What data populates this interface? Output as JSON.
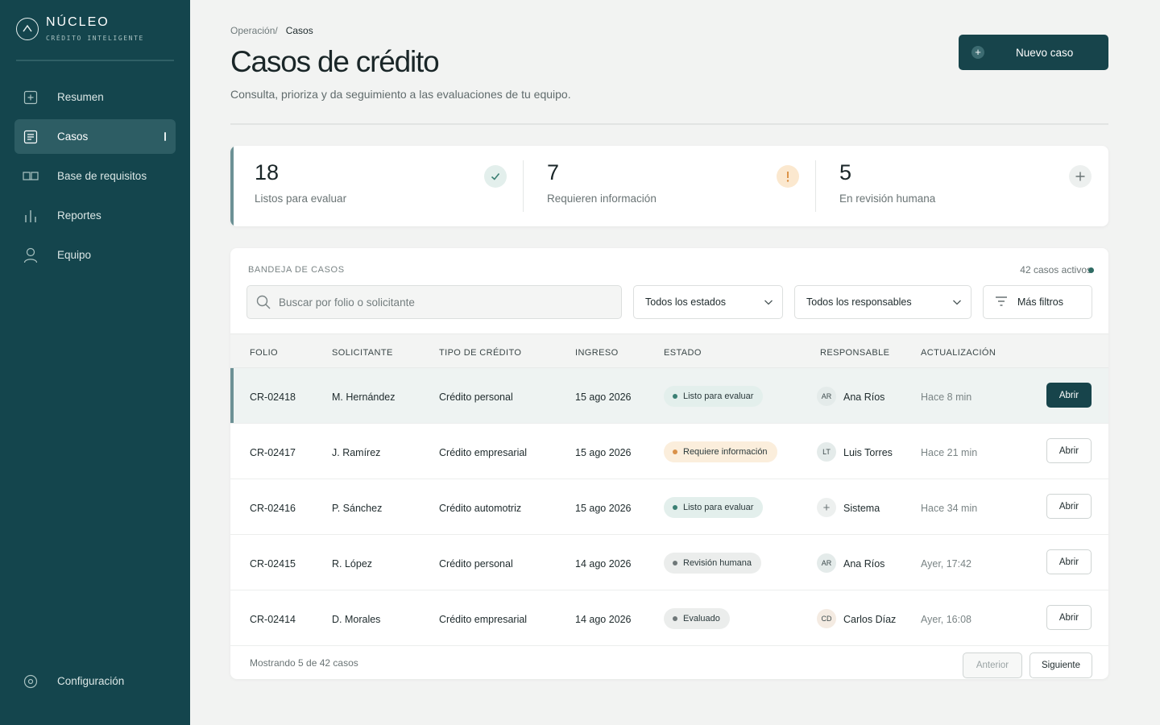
{
  "brand": {
    "name": "NÚCLEO",
    "tagline": "CRÉDITO INTELIGENTE"
  },
  "sidebar": {
    "items": [
      {
        "label": "Resumen",
        "icon": "plus-square-icon"
      },
      {
        "label": "Casos",
        "icon": "document-icon",
        "active": true
      },
      {
        "label": "Base de requisitos",
        "icon": "book-icon"
      },
      {
        "label": "Reportes",
        "icon": "bar-chart-icon"
      },
      {
        "label": "Equipo",
        "icon": "user-icon"
      }
    ],
    "footer_item": {
      "label": "Configuración",
      "icon": "settings-icon"
    }
  },
  "header": {
    "breadcrumb_parent": "Operación/",
    "breadcrumb_current": "Casos",
    "title": "Casos de crédito",
    "subtitle": "Consulta, prioriza y da seguimiento a las evaluaciones de tu equipo.",
    "new_case_label": "Nuevo caso"
  },
  "stats": [
    {
      "value": "18",
      "label": "Listos para evaluar",
      "icon": "check-icon"
    },
    {
      "value": "7",
      "label": "Requieren información",
      "icon": "alert-icon"
    },
    {
      "value": "5",
      "label": "En revisión humana",
      "icon": "plus-icon"
    }
  ],
  "cases": {
    "title": "BANDEJA DE CASOS",
    "count_label": "42 casos activos",
    "search_placeholder": "Buscar por folio o solicitante",
    "filter_status": "Todos los estados",
    "filter_owner": "Todos los responsables",
    "more_filters": "Más filtros",
    "columns": {
      "folio": "FOLIO",
      "applicant": "SOLICITANTE",
      "credit_type": "TIPO DE CRÉDITO",
      "intake": "INGRESO",
      "status": "ESTADO",
      "owner": "RESPONSABLE",
      "updated": "ACTUALIZACIÓN"
    },
    "rows": [
      {
        "folio": "CR-02418",
        "applicant": "M. Hernández",
        "credit_type": "Crédito personal",
        "intake": "15 ago 2026",
        "status": "Listo para evaluar",
        "status_kind": "green",
        "owner_initials": "AR",
        "owner": "Ana Ríos",
        "updated": "Hace 8 min",
        "action": "Abrir"
      },
      {
        "folio": "CR-02417",
        "applicant": "J. Ramírez",
        "credit_type": "Crédito empresarial",
        "intake": "15 ago 2026",
        "status": "Requiere información",
        "status_kind": "orange",
        "owner_initials": "LT",
        "owner": "Luis Torres",
        "updated": "Hace 21 min",
        "action": "Abrir"
      },
      {
        "folio": "CR-02416",
        "applicant": "P. Sánchez",
        "credit_type": "Crédito automotriz",
        "intake": "15 ago 2026",
        "status": "Listo para evaluar",
        "status_kind": "green",
        "owner_initials": "+",
        "owner": "Sistema",
        "updated": "Hace 34 min",
        "action": "Abrir"
      },
      {
        "folio": "CR-02415",
        "applicant": "R. López",
        "credit_type": "Crédito personal",
        "intake": "14 ago 2026",
        "status": "Revisión humana",
        "status_kind": "gray",
        "owner_initials": "AR",
        "owner": "Ana Ríos",
        "updated": "Ayer, 17:42",
        "action": "Abrir"
      },
      {
        "folio": "CR-02414",
        "applicant": "D. Morales",
        "credit_type": "Crédito empresarial",
        "intake": "14 ago 2026",
        "status": "Evaluado",
        "status_kind": "gray",
        "owner_initials": "CD",
        "owner": "Carlos Díaz",
        "updated": "Ayer, 16:08",
        "action": "Abrir"
      }
    ],
    "footer_text": "Mostrando 5 de 42 casos",
    "prev_label": "Anterior",
    "next_label": "Siguiente"
  },
  "colors": {
    "sidebar_bg": "#14454d",
    "primary": "#17444b",
    "status_green": "#3a7f73",
    "status_orange": "#d99149"
  }
}
